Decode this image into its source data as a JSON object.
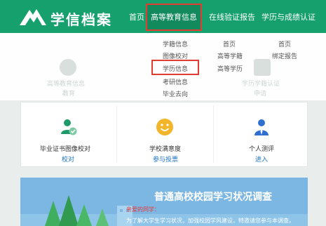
{
  "header": {
    "brand": "学信档案",
    "nav": [
      "首页",
      "高等教育信息",
      "在线验证报告",
      "学历与成绩认证"
    ],
    "active_index": 1
  },
  "dropdown": {
    "col1": [
      "学籍信息",
      "图像校对",
      "学历信息",
      "考研信息",
      "毕业去向"
    ],
    "col2": [
      "首页",
      "高等学籍",
      "高等学历"
    ],
    "col3": [
      "首页",
      "绑定报告"
    ],
    "highlighted": "学历信息"
  },
  "background_hint": {
    "left_title": "高等教育信息",
    "left_sub": "教育",
    "right_title": "学历学籍认证",
    "right_sub": "申请"
  },
  "cards": [
    {
      "title": "毕业证书图像校对",
      "link": "校对",
      "icon": "graduate-user-check-icon"
    },
    {
      "title": "学校满意度",
      "link": "参与投票",
      "icon": "smiley-face-icon"
    },
    {
      "title": "个人测评",
      "link": "进入",
      "icon": "person-suit-icon"
    }
  ],
  "banner": {
    "title": "普通高校校园学习状况调查",
    "greeting": "亲爱的同学：",
    "body": "为了解大学生学习状况，加强校园学风建设，特邀请您参与本调查。"
  },
  "colors": {
    "header_green": "#16a06e",
    "highlight_red": "#e23b2f",
    "link_blue": "#1b73c7",
    "banner_blue": "#7bb7e2"
  }
}
